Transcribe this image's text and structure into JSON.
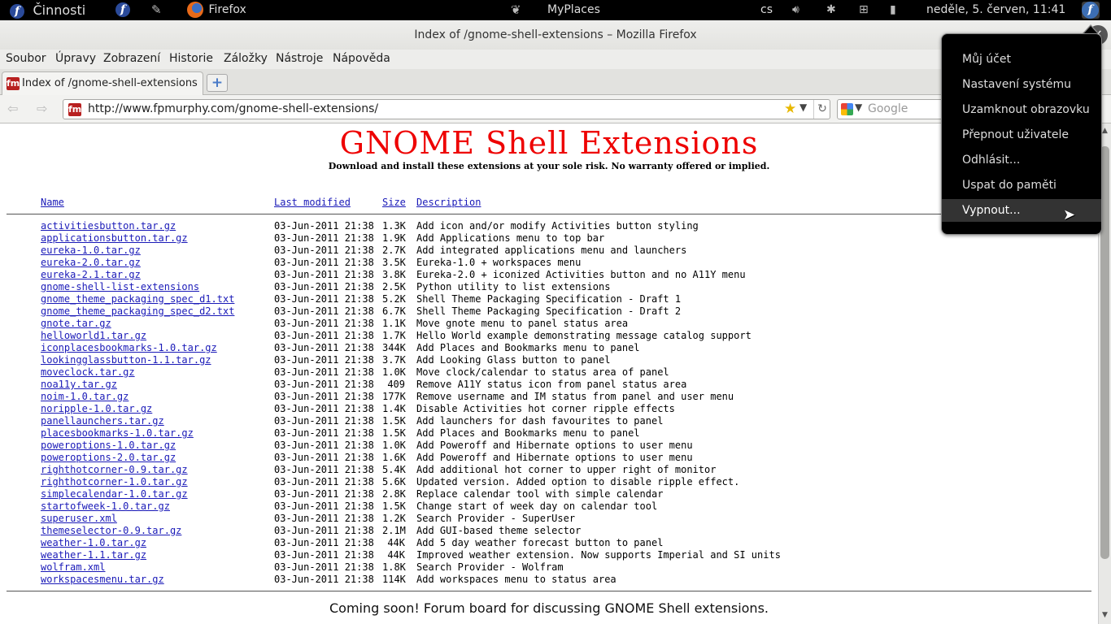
{
  "panel": {
    "activities": "Činnosti",
    "app_name": "Firefox",
    "center_app": "MyPlaces",
    "lang": "cs",
    "clock": "neděle,  5. červen, 11:41"
  },
  "window": {
    "title": "Index of /gnome-shell-extensions – Mozilla Firefox"
  },
  "menubar": {
    "items": [
      {
        "label": "Soubor"
      },
      {
        "label": "Úpravy"
      },
      {
        "label": "Zobrazení"
      },
      {
        "label": "Historie"
      },
      {
        "label": "Záložky"
      },
      {
        "label": "Nástroje"
      },
      {
        "label": "Nápověda"
      }
    ]
  },
  "tab": {
    "title": "Index of /gnome-shell-extensions"
  },
  "nav": {
    "url": "http://www.fpmurphy.com/gnome-shell-extensions/",
    "search_placeholder": "Google"
  },
  "page": {
    "title": "GNOME Shell Extensions",
    "subtitle": "Download and install these extensions at your sole risk. No warranty offered or implied.",
    "headers": {
      "name": "Name",
      "modified": "Last modified",
      "size": "Size",
      "description": "Description"
    },
    "files": [
      {
        "name": "activitiesbutton.tar.gz",
        "date": "03-Jun-2011 21:38",
        "size": "1.3K",
        "desc": "Add icon and/or modify Activities button styling"
      },
      {
        "name": "applicationsbutton.tar.gz",
        "date": "03-Jun-2011 21:38",
        "size": "1.9K",
        "desc": "Add Applications menu to top bar"
      },
      {
        "name": "eureka-1.0.tar.gz",
        "date": "03-Jun-2011 21:38",
        "size": "2.7K",
        "desc": "Add integrated applications menu and launchers"
      },
      {
        "name": "eureka-2.0.tar.gz",
        "date": "03-Jun-2011 21:38",
        "size": "3.5K",
        "desc": "Eureka-1.0 + workspaces menu"
      },
      {
        "name": "eureka-2.1.tar.gz",
        "date": "03-Jun-2011 21:38",
        "size": "3.8K",
        "desc": "Eureka-2.0 + iconized Activities button and no A11Y menu"
      },
      {
        "name": "gnome-shell-list-extensions",
        "date": "03-Jun-2011 21:38",
        "size": "2.5K",
        "desc": "Python utility to list extensions"
      },
      {
        "name": "gnome_theme_packaging_spec_d1.txt",
        "date": "03-Jun-2011 21:38",
        "size": "5.2K",
        "desc": "Shell Theme Packaging Specification - Draft 1"
      },
      {
        "name": "gnome_theme_packaging_spec_d2.txt",
        "date": "03-Jun-2011 21:38",
        "size": "6.7K",
        "desc": "Shell Theme Packaging Specification - Draft 2"
      },
      {
        "name": "gnote.tar.gz",
        "date": "03-Jun-2011 21:38",
        "size": "1.1K",
        "desc": "Move gnote menu to panel status area"
      },
      {
        "name": "helloworld1.tar.gz",
        "date": "03-Jun-2011 21:38",
        "size": "1.7K",
        "desc": "Hello World example demonstrating message catalog support"
      },
      {
        "name": "iconplacesbookmarks-1.0.tar.gz",
        "date": "03-Jun-2011 21:38",
        "size": "344K",
        "desc": "Add Places and Bookmarks menu to panel"
      },
      {
        "name": "lookingglassbutton-1.1.tar.gz",
        "date": "03-Jun-2011 21:38",
        "size": "3.7K",
        "desc": "Add Looking Glass button to panel"
      },
      {
        "name": "moveclock.tar.gz",
        "date": "03-Jun-2011 21:38",
        "size": "1.0K",
        "desc": "Move clock/calendar to status area of panel"
      },
      {
        "name": "noa11y.tar.gz",
        "date": "03-Jun-2011 21:38",
        "size": "409",
        "desc": "Remove A11Y status icon from panel status area"
      },
      {
        "name": "noim-1.0.tar.gz",
        "date": "03-Jun-2011 21:38",
        "size": "177K",
        "desc": "Remove username and IM status from panel and user menu"
      },
      {
        "name": "noripple-1.0.tar.gz",
        "date": "03-Jun-2011 21:38",
        "size": "1.4K",
        "desc": "Disable Activities hot corner ripple effects"
      },
      {
        "name": "panellaunchers.tar.gz",
        "date": "03-Jun-2011 21:38",
        "size": "1.5K",
        "desc": "Add launchers for dash favourites to panel"
      },
      {
        "name": "placesbookmarks-1.0.tar.gz",
        "date": "03-Jun-2011 21:38",
        "size": "1.5K",
        "desc": "Add Places and Bookmarks menu to panel"
      },
      {
        "name": "poweroptions-1.0.tar.gz",
        "date": "03-Jun-2011 21:38",
        "size": "1.0K",
        "desc": "Add Poweroff and Hibernate options to user menu"
      },
      {
        "name": "poweroptions-2.0.tar.gz",
        "date": "03-Jun-2011 21:38",
        "size": "1.6K",
        "desc": "Add Poweroff and Hibernate options to user menu"
      },
      {
        "name": "righthotcorner-0.9.tar.gz",
        "date": "03-Jun-2011 21:38",
        "size": "5.4K",
        "desc": "Add additional hot corner to upper right of monitor"
      },
      {
        "name": "righthotcorner-1.0.tar.gz",
        "date": "03-Jun-2011 21:38",
        "size": "5.6K",
        "desc": "Updated version. Added option to disable ripple effect."
      },
      {
        "name": "simplecalendar-1.0.tar.gz",
        "date": "03-Jun-2011 21:38",
        "size": "2.8K",
        "desc": "Replace calendar tool with simple calendar"
      },
      {
        "name": "startofweek-1.0.tar.gz",
        "date": "03-Jun-2011 21:38",
        "size": "1.5K",
        "desc": "Change start of week day on calendar tool"
      },
      {
        "name": "superuser.xml",
        "date": "03-Jun-2011 21:38",
        "size": "1.2K",
        "desc": "Search Provider - SuperUser"
      },
      {
        "name": "themeselector-0.9.tar.gz",
        "date": "03-Jun-2011 21:38",
        "size": "2.1M",
        "desc": "Add GUI-based theme selector"
      },
      {
        "name": "weather-1.0.tar.gz",
        "date": "03-Jun-2011 21:38",
        "size": "44K",
        "desc": "Add 5 day weather forecast button to panel"
      },
      {
        "name": "weather-1.1.tar.gz",
        "date": "03-Jun-2011 21:38",
        "size": "44K",
        "desc": "Improved weather extension. Now supports Imperial and SI units"
      },
      {
        "name": "wolfram.xml",
        "date": "03-Jun-2011 21:38",
        "size": "1.8K",
        "desc": "Search Provider - Wolfram"
      },
      {
        "name": "workspacesmenu.tar.gz",
        "date": "03-Jun-2011 21:38",
        "size": "114K",
        "desc": "Add workspaces menu to status area"
      }
    ],
    "footer": "Coming soon! Forum board for discussing GNOME Shell extensions."
  },
  "user_menu": {
    "items": [
      {
        "label": "Můj účet"
      },
      {
        "label": "Nastavení systému"
      },
      {
        "label": "Uzamknout obrazovku"
      },
      {
        "label": "Přepnout uživatele"
      },
      {
        "label": "Odhlásit..."
      },
      {
        "label": "Uspat do paměti"
      },
      {
        "label": "Vypnout..."
      }
    ],
    "highlighted_index": 6
  }
}
